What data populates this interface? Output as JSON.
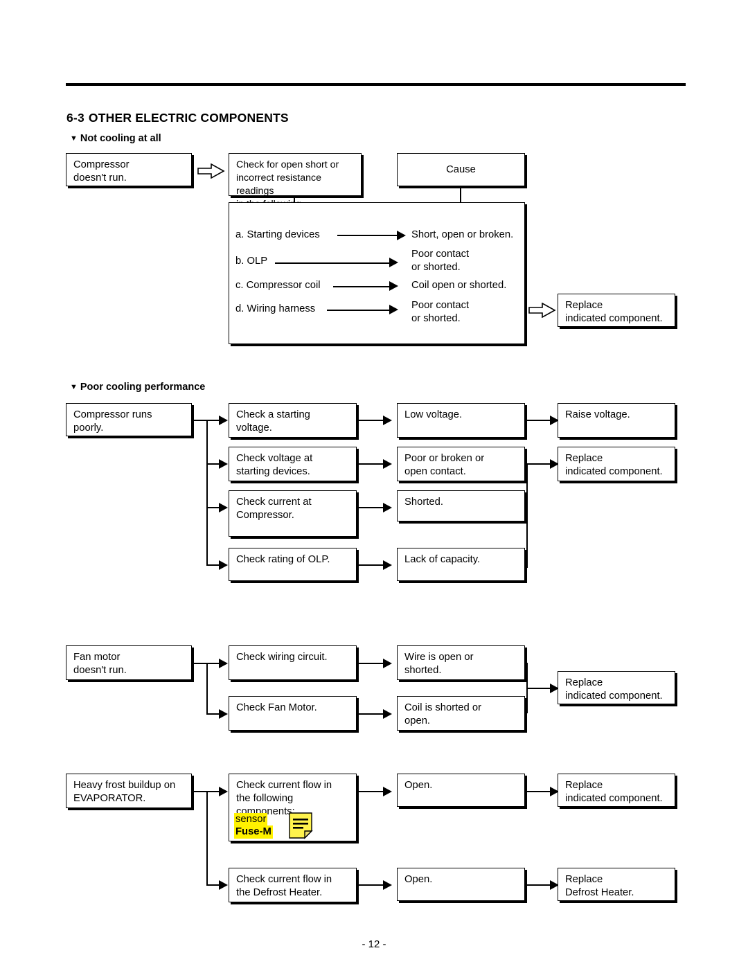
{
  "document": {
    "section_number": "6-3",
    "section_title": "OTHER ELECTRIC COMPONENTS",
    "page_number": "- 12 -"
  },
  "sections": [
    {
      "heading": "Not cooling at all",
      "symptom": "Compressor\ndoesn't run.",
      "check_block": "Check for open short or\nincorrect resistance readings\nin the following components",
      "cause_header": "Cause",
      "items": [
        {
          "label": "a. Starting devices",
          "cause": "Short, open or broken."
        },
        {
          "label": "b. OLP",
          "cause": "Poor contact\nor shorted."
        },
        {
          "label": "c. Compressor coil",
          "cause": "Coil open or shorted."
        },
        {
          "label": "d. Wiring harness",
          "cause": "Poor contact\nor shorted."
        }
      ],
      "action": "Replace\nindicated component."
    },
    {
      "heading": "Poor cooling performance",
      "symptom": "Compressor runs\npoorly.",
      "rows": [
        {
          "check": "Check a starting\nvoltage.",
          "result": "Low voltage.",
          "action": "Raise voltage."
        },
        {
          "check": "Check voltage at\nstarting devices.",
          "result": "Poor or broken or\nopen contact.",
          "action": "Replace\nindicated component."
        },
        {
          "check": "Check current at\nCompressor.",
          "result": "Shorted.",
          "action": ""
        },
        {
          "check": "Check rating of OLP.",
          "result": "Lack of capacity.",
          "action": ""
        }
      ]
    },
    {
      "heading": "",
      "symptom": "Fan motor\ndoesn't run.",
      "rows": [
        {
          "check": "Check wiring circuit.",
          "result": "Wire is open or\nshorted.",
          "action": "Replace\nindicated component."
        },
        {
          "check": "Check Fan Motor.",
          "result": "Coil is shorted or\nopen.",
          "action": ""
        }
      ]
    },
    {
      "heading": "",
      "symptom": "Heavy frost buildup on\nEVAPORATOR.",
      "rows": [
        {
          "check": "Check current flow in\nthe following\ncomponents:",
          "result": "Open.",
          "action": "Replace\nindicated component."
        },
        {
          "check": "Check current flow in\nthe Defrost Heater.",
          "result": "Open.",
          "action": "Replace\nDefrost Heater."
        }
      ],
      "highlight": {
        "line1": "sensor",
        "line2": "Fuse-M"
      }
    }
  ],
  "icons": {
    "triangle_bullet": "▼",
    "note_icon": "sticky-note-icon"
  }
}
